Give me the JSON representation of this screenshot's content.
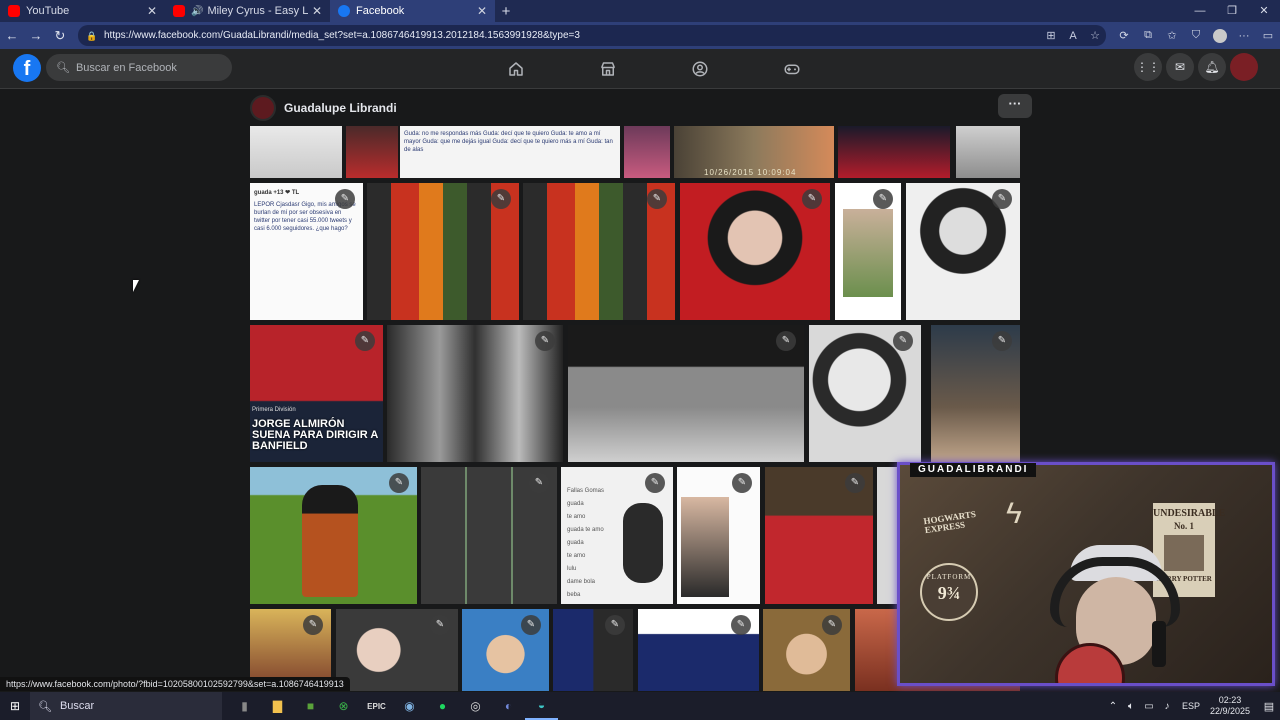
{
  "browser": {
    "tabs": [
      {
        "title": "YouTube",
        "favicon_color": "#ff0000",
        "active": false
      },
      {
        "title": "Miley Cyrus - Easy Lover (Off",
        "favicon_color": "#ff0000",
        "active": false,
        "audio": true
      },
      {
        "title": "Facebook",
        "favicon_color": "#1877f2",
        "active": true
      }
    ],
    "url": "https://www.facebook.com/GuadaLibrandi/media_set?set=a.1086746419913.2012184.1563991928&type=3",
    "status_url": "https://www.facebook.com/photo/?fbid=10205800102592799&set=a.1086746419913"
  },
  "facebook": {
    "logo": "f",
    "search_placeholder": "Buscar en Facebook",
    "profile_name": "Guadalupe Librandi",
    "more_label": "···",
    "nav_icons": [
      "home-icon",
      "marketplace-icon",
      "groups-icon",
      "gaming-icon"
    ],
    "right_icons": [
      "menu-grid-icon",
      "messenger-icon",
      "notifications-icon",
      "account-avatar"
    ]
  },
  "photos": {
    "news_caption": "JORGE ALMIRÓN SUENA PARA DIRIGIR A BANFIELD",
    "news_kicker": "Primera División",
    "tweet_text": "LEPOR Cjasdasr Gigo, mis amigos se burlan de mí por ser obsesiva en twitter por tener casi 55.000 tweets y casi 6.000 seguidores. ¿que hago?",
    "tweet_handle": "guada +13 ❤ TL",
    "list_text": "Fallas Gomas\nguada\nte amo\nguada te amo\nguada\nte amo\nlulu\ndame bola\nbeba\nte rencil amo",
    "timestamp": "10/26/2015 10:09:04",
    "chat_lines": "Guda: no me respondas más\nGuda: decí que te quiero\nGuda: te amo a mí mayor\nGuda: que me dejás igual\nGuda: decí que te quiero más a mí\nGuda: tan de alas"
  },
  "stream": {
    "channel_label": "GUADALIBRANDI",
    "poster_title": "UNDESIRABLE",
    "poster_sub": "No. 1",
    "poster_name": "HARRY POTTER",
    "platform_label": "PLATFORM",
    "platform_number": "9¾",
    "hogwarts_label": "HOGWARTS EXPRESS",
    "frame_color": "#6a4fc9"
  },
  "taskbar": {
    "search_label": "Buscar",
    "lang": "ESP",
    "time": "02:23",
    "date": "22/9/2025"
  }
}
